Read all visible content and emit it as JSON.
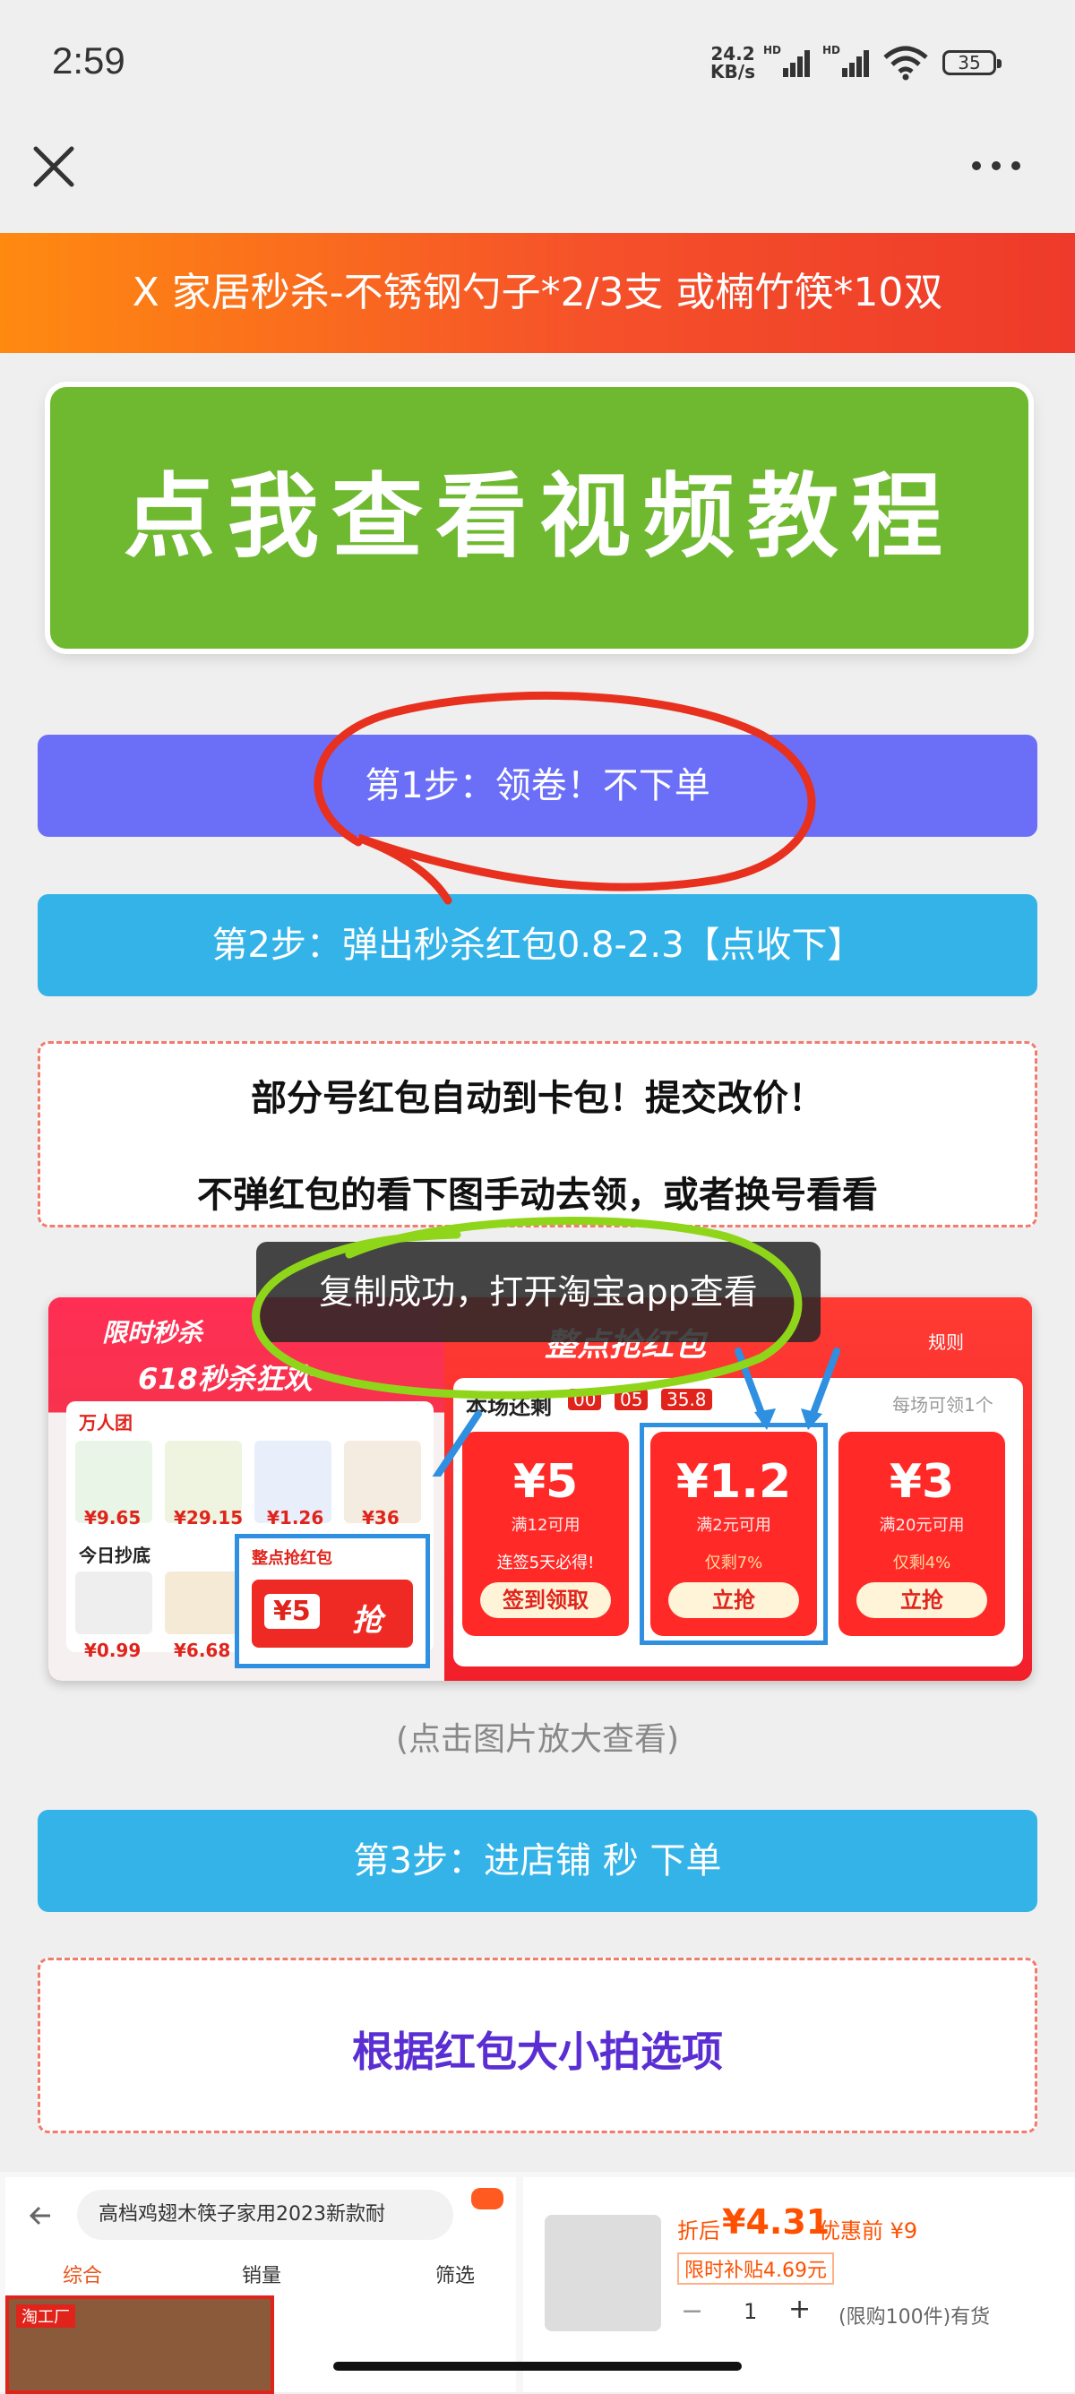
{
  "status_bar": {
    "time": "2:59",
    "net_speed_value": "24.2",
    "net_speed_unit": "KB/s",
    "signal1_label": "HD",
    "signal2_label": "HD",
    "battery": "35"
  },
  "banner": {
    "text": "X 家居秒杀-不锈钢勺子*2/3支 或楠竹筷*10双"
  },
  "video_button": {
    "label": "点我查看视频教程"
  },
  "steps": {
    "step1": "第1步：领卷！不下单",
    "step2": "第2步：弹出秒杀红包0.8-2.3【点收下】",
    "step3": "第3步：进店铺 秒 下单"
  },
  "note": {
    "line1": "部分号红包自动到卡包！提交改价！",
    "line2": "不弹红包的看下图手动去领，或者换号看看"
  },
  "toast": {
    "text": "复制成功，打开淘宝app查看"
  },
  "promo_image": {
    "left_title": "限时秒杀",
    "left_sub": "618秒杀狂欢",
    "brand": "万人团",
    "today": "今日抄底",
    "prices": [
      "¥9.65",
      "¥29.15",
      "¥1.26",
      "¥36",
      "¥0.99",
      "¥6.68"
    ],
    "mini_coupon_title": "整点抢红包",
    "mini_coupon_value": "¥5",
    "mini_coupon_btn": "抢",
    "right_title": "整点抢红包",
    "rules": "规则",
    "remaining": "本场还剩",
    "countdown": [
      "00",
      "05",
      "35.8"
    ],
    "per_session": "每场可领1个",
    "coupons": [
      {
        "value": "¥5",
        "cond": "满12可用",
        "extra": "连签5天必得!",
        "btn": "签到领取"
      },
      {
        "value": "¥1.2",
        "cond": "满2元可用",
        "extra": "仅剩7%",
        "btn": "立抢"
      },
      {
        "value": "¥3",
        "cond": "满20元可用",
        "extra": "仅剩4%",
        "btn": "立抢"
      }
    ]
  },
  "caption": "(点击图片放大查看)",
  "option": {
    "text": "根据红包大小拍选项"
  },
  "bottom_preview": {
    "search_text": "高档鸡翅木筷子家用2023新款耐",
    "tabs": [
      "综合",
      "销量",
      "筛选"
    ],
    "badge": "淘工厂",
    "price_prefix": "折后",
    "price": "¥4.31",
    "price_before": "优惠前 ¥9",
    "subsidy": "限时补贴4.69元",
    "qty": "1",
    "limit": "(限购100件)有货"
  },
  "colors": {
    "banner_start": "#ff8a10",
    "banner_end": "#ee3a2a",
    "video_green": "#6fb930",
    "step1_purple": "#6b6ff8",
    "step_blue": "#34b3e8",
    "option_purple": "#5a2ed3",
    "annotation_red": "#e8301e",
    "annotation_green": "#8fd61a"
  }
}
